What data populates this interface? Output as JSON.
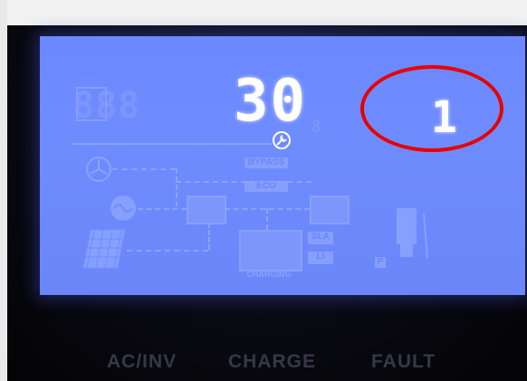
{
  "display": {
    "main_value": "30",
    "secondary_value": "1",
    "wrench_icon": "wrench-icon"
  },
  "panel_labels": {
    "ac_inv": "AC/INV",
    "charge": "CHARGE",
    "fault": "FAULT"
  },
  "ghost_segments": {
    "bypass_tag": "BYPASS",
    "eco_tag": "ECO",
    "sla_tag": "SLA",
    "li_tag": "LI",
    "charging_label": "CHARGING",
    "p_tag": "P"
  },
  "colors": {
    "lcd_background": "#6f8cff",
    "lit_segment": "#ffffff",
    "annotation_ring": "#e80000"
  }
}
